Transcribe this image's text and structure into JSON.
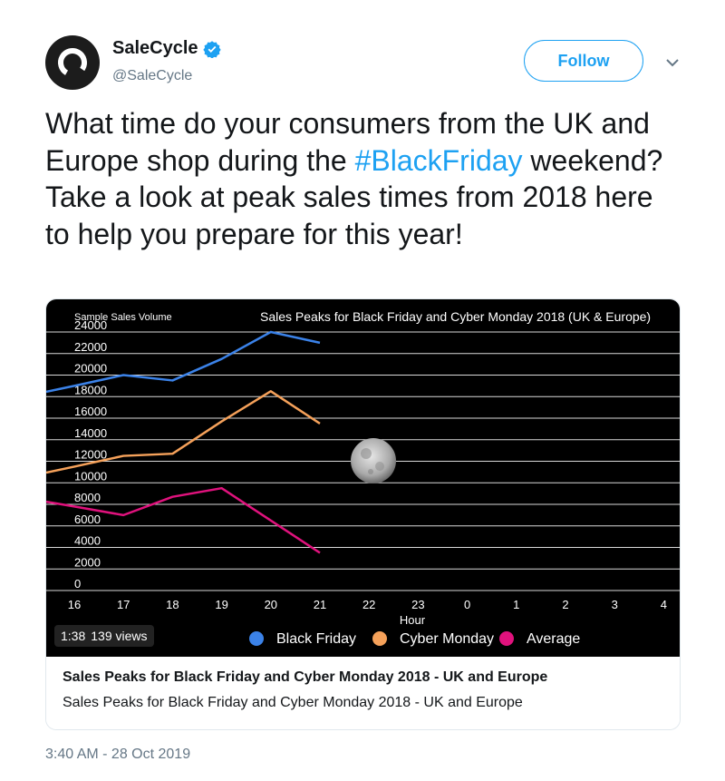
{
  "account": {
    "name": "SaleCycle",
    "handle": "@SaleCycle",
    "follow_label": "Follow",
    "avatar_icon": "salecycle-logo-icon",
    "verified_icon": "verified-badge-icon",
    "menu_icon": "chevron-down-icon"
  },
  "tweet": {
    "text_before": "What time do your consumers from the UK and Europe shop during the ",
    "hashtag": "#BlackFriday",
    "text_after": " weekend? Take a look at peak sales times from 2018 here to help you prepare for this year!",
    "timestamp": "3:40 AM - 28 Oct 2019"
  },
  "video": {
    "duration": "1:38",
    "views": "139 views"
  },
  "card": {
    "title": "Sales Peaks for Black Friday and Cyber Monday 2018 - UK and Europe",
    "description": "Sales Peaks for Black Friday and Cyber Monday 2018 - UK and Europe"
  },
  "colors": {
    "accent": "#1da1f2",
    "black_friday": "#3b82e8",
    "cyber_monday": "#f5a15a",
    "average": "#e0127d"
  },
  "chart_data": {
    "type": "line",
    "title": "Sales Peaks for Black Friday and Cyber Monday 2018 (UK & Europe)",
    "ylabel": "Sample Sales Volume",
    "xlabel": "Hour",
    "x": [
      "16",
      "17",
      "18",
      "19",
      "20",
      "21",
      "22",
      "23",
      "0",
      "1",
      "2",
      "3",
      "4"
    ],
    "ylim": [
      0,
      24000
    ],
    "yticks": [
      0,
      2000,
      4000,
      6000,
      8000,
      10000,
      12000,
      14000,
      16000,
      18000,
      20000,
      22000,
      24000
    ],
    "grid": true,
    "legend": "bottom",
    "series": [
      {
        "name": "Black Friday",
        "color": "#3b82e8",
        "values": [
          19000,
          20000,
          19500,
          21500,
          24000,
          23000
        ]
      },
      {
        "name": "Cyber Monday",
        "color": "#f5a15a",
        "values": [
          11500,
          12500,
          12700,
          15700,
          18500,
          15500
        ]
      },
      {
        "name": "Average",
        "color": "#e0127d",
        "values": [
          7800,
          7000,
          8700,
          9500,
          6500,
          3500
        ]
      }
    ]
  }
}
